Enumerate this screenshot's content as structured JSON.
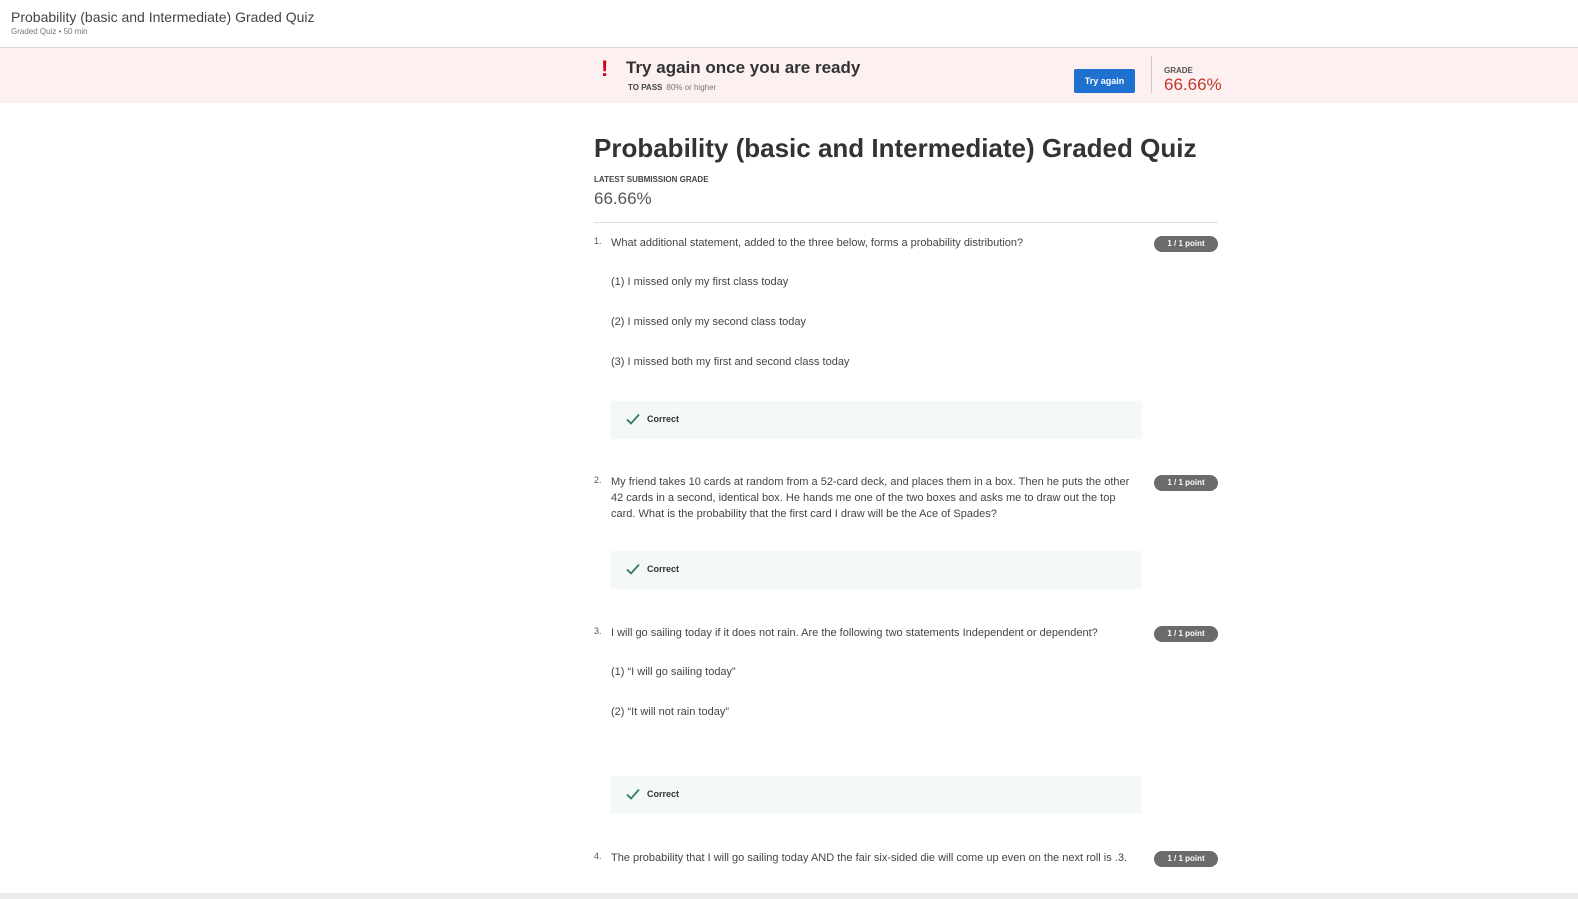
{
  "topbar": {
    "title": "Probability (basic and Intermediate) Graded Quiz",
    "subtitle": "Graded Quiz • 50 min"
  },
  "banner": {
    "icon": "exclamation-icon",
    "title": "Try again once you are ready",
    "pass_label": "TO PASS",
    "pass_value": "80% or higher",
    "button": "Try again",
    "grade_label": "GRADE",
    "grade_value": "66.66%",
    "colors": {
      "background": "#fdf0f1",
      "grade": "#c0392b",
      "button": "#1f71d0",
      "icon": "#d0021b"
    }
  },
  "main": {
    "title": "Probability (basic and Intermediate) Graded Quiz",
    "latest_label": "LATEST SUBMISSION GRADE",
    "latest_value": "66.66%"
  },
  "questions": [
    {
      "num": "1.",
      "text": "What additional statement, added to the three below, forms a probability distribution?",
      "points": "1 / 1 point",
      "options": [
        "(1) I missed only my first class today",
        "(2) I missed only my second class today",
        "(3) I missed both my first and second class today"
      ],
      "result": "Correct"
    },
    {
      "num": "2.",
      "text": "My friend takes 10 cards at random from a 52-card deck, and places them in a box. Then he puts the other 42 cards in a second, identical box. He hands me one of the two boxes and asks me to draw out the top card. What is the probability that the first card I draw will be the Ace of Spades?",
      "points": "1 / 1 point",
      "result": "Correct"
    },
    {
      "num": "3.",
      "text": "I will go sailing today if it does not rain.  Are the following two statements Independent or dependent?",
      "points": "1 / 1 point",
      "options": [
        "(1) “I will go sailing today”",
        "(2) “It will not rain today”"
      ],
      "result": "Correct"
    },
    {
      "num": "4.",
      "text": "The probability that I will go sailing today AND the fair six-sided die will come up even on the next roll is .3.",
      "points": "1 / 1 point"
    }
  ],
  "correct_color": "#2e7d5b"
}
